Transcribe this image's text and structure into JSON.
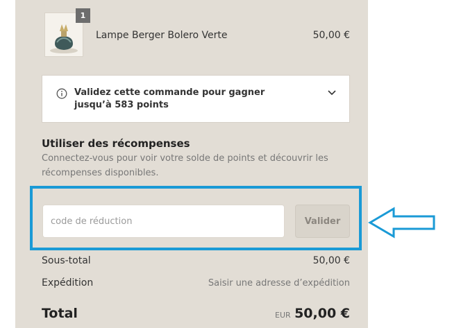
{
  "cart": {
    "item": {
      "quantity": "1",
      "name": "Lampe Berger Bolero Verte",
      "price": "50,00 €"
    }
  },
  "loyalty": {
    "message": "Validez cette commande pour gagner jusqu’à 583 points"
  },
  "rewards": {
    "title": "Utiliser des récompenses",
    "description": "Connectez-vous pour voir votre solde de points et découvrir les récompenses disponibles."
  },
  "discount": {
    "placeholder": "code de réduction",
    "value": "",
    "apply_label": "Valider"
  },
  "summary": {
    "subtotal_label": "Sous-total",
    "subtotal_value": "50,00 €",
    "shipping_label": "Expédition",
    "shipping_value": "Saisir une adresse d’expédition",
    "total_label": "Total",
    "total_currency": "EUR",
    "total_value": "50,00 €"
  },
  "icons": {
    "info": "info-circle-icon",
    "expand": "chevron-down-icon",
    "annotation": "left-arrow-outline-icon"
  },
  "colors": {
    "panel_background": "#e2ddd5",
    "highlight_border": "#1a9ad6",
    "text_primary": "#333333",
    "text_secondary": "#777777"
  }
}
